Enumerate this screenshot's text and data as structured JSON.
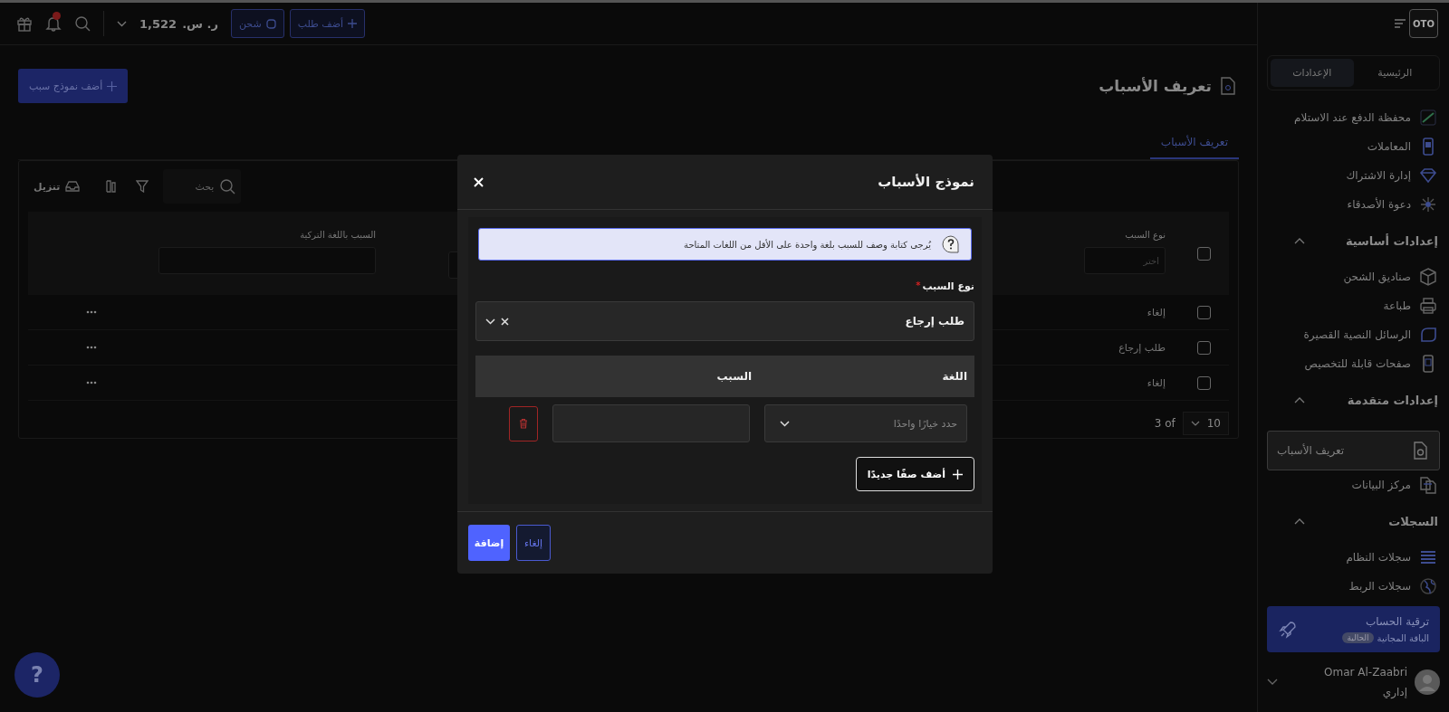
{
  "sidebar": {
    "logo": "OTO",
    "tabs": [
      {
        "label": "الرئيسية",
        "selected": false
      },
      {
        "label": "الإعدادات",
        "selected": true
      }
    ],
    "groups": [
      {
        "items": [
          {
            "label": "محفظة الدفع عند الاستلام",
            "selected": false
          },
          {
            "label": "المعاملات",
            "selected": false
          },
          {
            "label": "إدارة الاشتراك",
            "selected": false
          },
          {
            "label": "دعوة الأصدقاء",
            "selected": false
          }
        ]
      },
      {
        "heading": "إعدادات أساسية",
        "expanded": true,
        "items": [
          {
            "label": "صناديق الشحن",
            "selected": false
          },
          {
            "label": "طباعة",
            "selected": false
          },
          {
            "label": "الرسائل النصية القصيرة",
            "selected": false
          },
          {
            "label": "صفحات قابلة للتخصيص",
            "selected": false
          }
        ]
      },
      {
        "heading": "إعدادات متقدمة",
        "expanded": true,
        "items": [
          {
            "label": "تعريف الأسباب",
            "selected": true
          },
          {
            "label": "مركز البيانات",
            "selected": false
          }
        ]
      },
      {
        "heading": "السجلات",
        "expanded": true,
        "items": [
          {
            "label": "سجلات النظام",
            "selected": false
          },
          {
            "label": "سجلات الربط",
            "selected": false
          }
        ]
      }
    ],
    "upgrade": {
      "title": "ترقية الحساب",
      "plan": "الباقة المجانية",
      "badge": "الحالية"
    },
    "user": {
      "name": "Omar Al-Zaabri",
      "role": "إداري"
    }
  },
  "topbar": {
    "add_order": "أضف طلب",
    "ship": "شحن",
    "amount": "1,522",
    "currency": "ر. س.",
    "has_notifications": true
  },
  "page": {
    "title": "تعريف الأسباب",
    "add_button": "أضف نموذج سبب",
    "tabs": [
      {
        "label": "تعريف الأسباب",
        "selected": true
      }
    ]
  },
  "table": {
    "search_placeholder": "بحث",
    "download": "تنزيل",
    "select_all_checked": false,
    "columns": [
      {
        "label": "نوع السبب",
        "placeholder": "اختر"
      },
      {
        "label": "السبب باللغة التركية"
      }
    ],
    "rows": [
      {
        "type": "إلغاء",
        "checked": false
      },
      {
        "type": "طلب إرجاع",
        "checked": false
      },
      {
        "type": "إلغاء",
        "checked": false
      }
    ],
    "page_size": "10",
    "page_count": "3 of"
  },
  "help": "?",
  "modal": {
    "title": "نموذج الأسباب",
    "info": "يُرجى كتابة وصف للسبب بلغة واحدة على الأقل من اللغات المتاحة",
    "type_label": "نوع السبب",
    "required_mark": "*",
    "type_value": "طلب إرجاع",
    "columns": [
      "اللغة",
      "السبب"
    ],
    "rows": [
      {
        "language_placeholder": "حدد خيارًا واحدًا"
      }
    ],
    "add_row": "أضف صفًا جديدًا",
    "submit": "إضافة",
    "cancel": "إلغاء"
  }
}
